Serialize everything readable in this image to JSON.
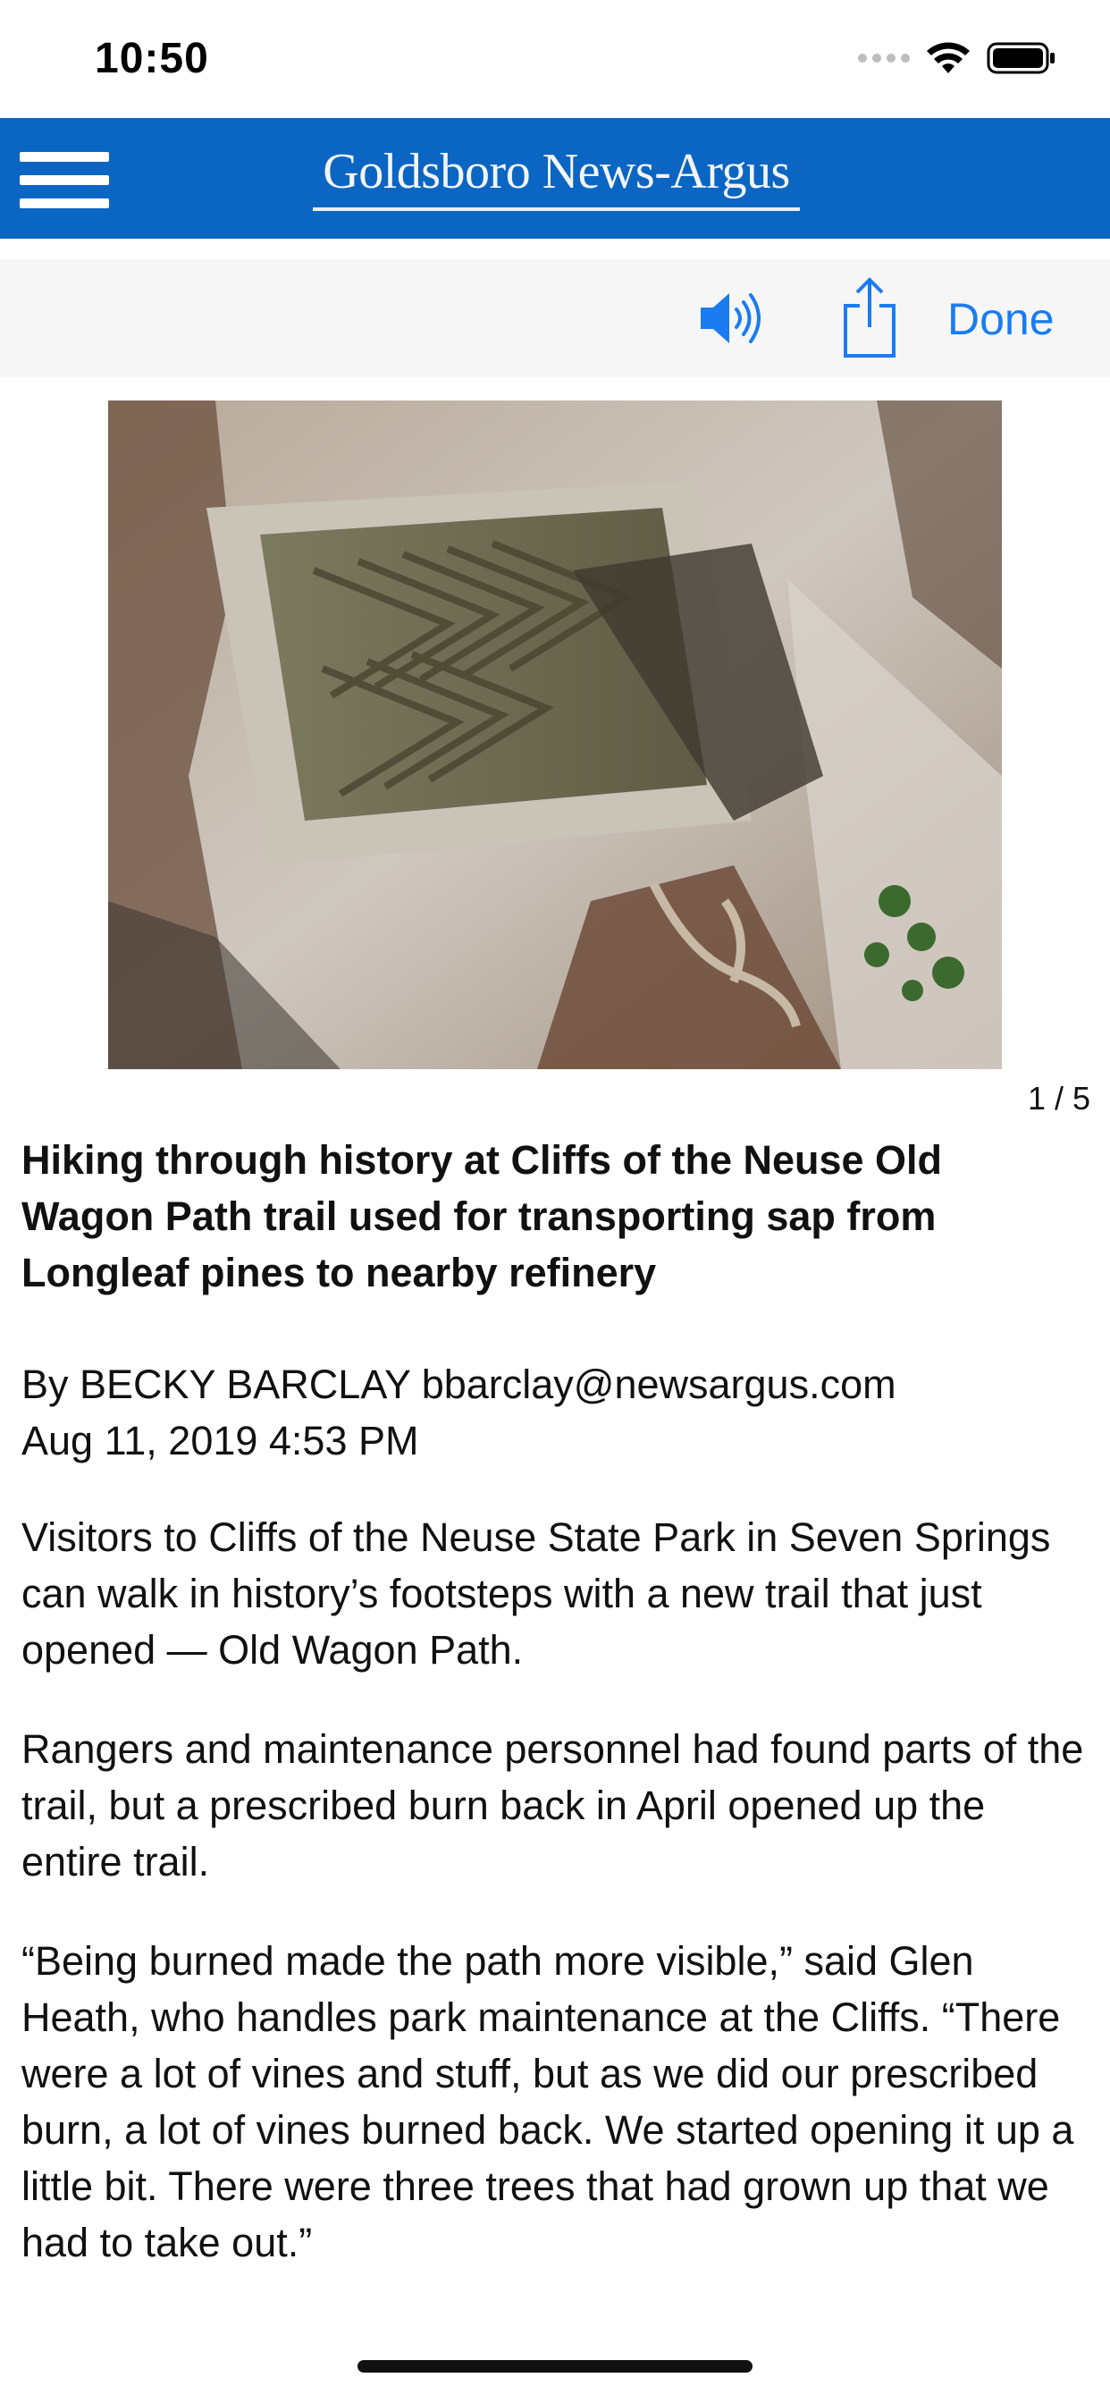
{
  "status_bar": {
    "time": "10:50"
  },
  "masthead": {
    "brand": "Goldsboro News-Argus"
  },
  "toolbar": {
    "done_label": "Done"
  },
  "gallery": {
    "counter": "1 / 5"
  },
  "article": {
    "headline": "Hiking through history at Cliffs of the Neuse Old Wagon Path trail used for transporting sap from Longleaf pines to nearby refinery",
    "byline": "By BECKY BARCLAY bbarclay@newsargus.com",
    "dateline": "Aug 11, 2019 4:53 PM",
    "paragraphs": [
      "Visitors to Cliffs of the Neuse State Park in Seven Springs can walk in history’s footsteps with a new trail that just opened — Old Wagon Path.",
      "Rangers and maintenance personnel had found parts of the trail, but a prescribed burn back in April opened up the entire trail.",
      "“Being burned made the path more visible,” said Glen Heath, who handles park maintenance at the Cliffs. “There were a lot of vines and stuff, but as we did our prescribed burn, a lot of vines burned back. We started opening it up a little bit. There were three trees that had grown up that we had to take out.”"
    ]
  },
  "colors": {
    "masthead": "#0a66c2",
    "accent": "#1a7cf0",
    "toolbar_bg": "#f6f6f6"
  },
  "icons": {
    "menu": "hamburger-icon",
    "speaker": "speaker-icon",
    "share": "share-icon",
    "wifi": "wifi-icon",
    "battery": "battery-icon"
  }
}
